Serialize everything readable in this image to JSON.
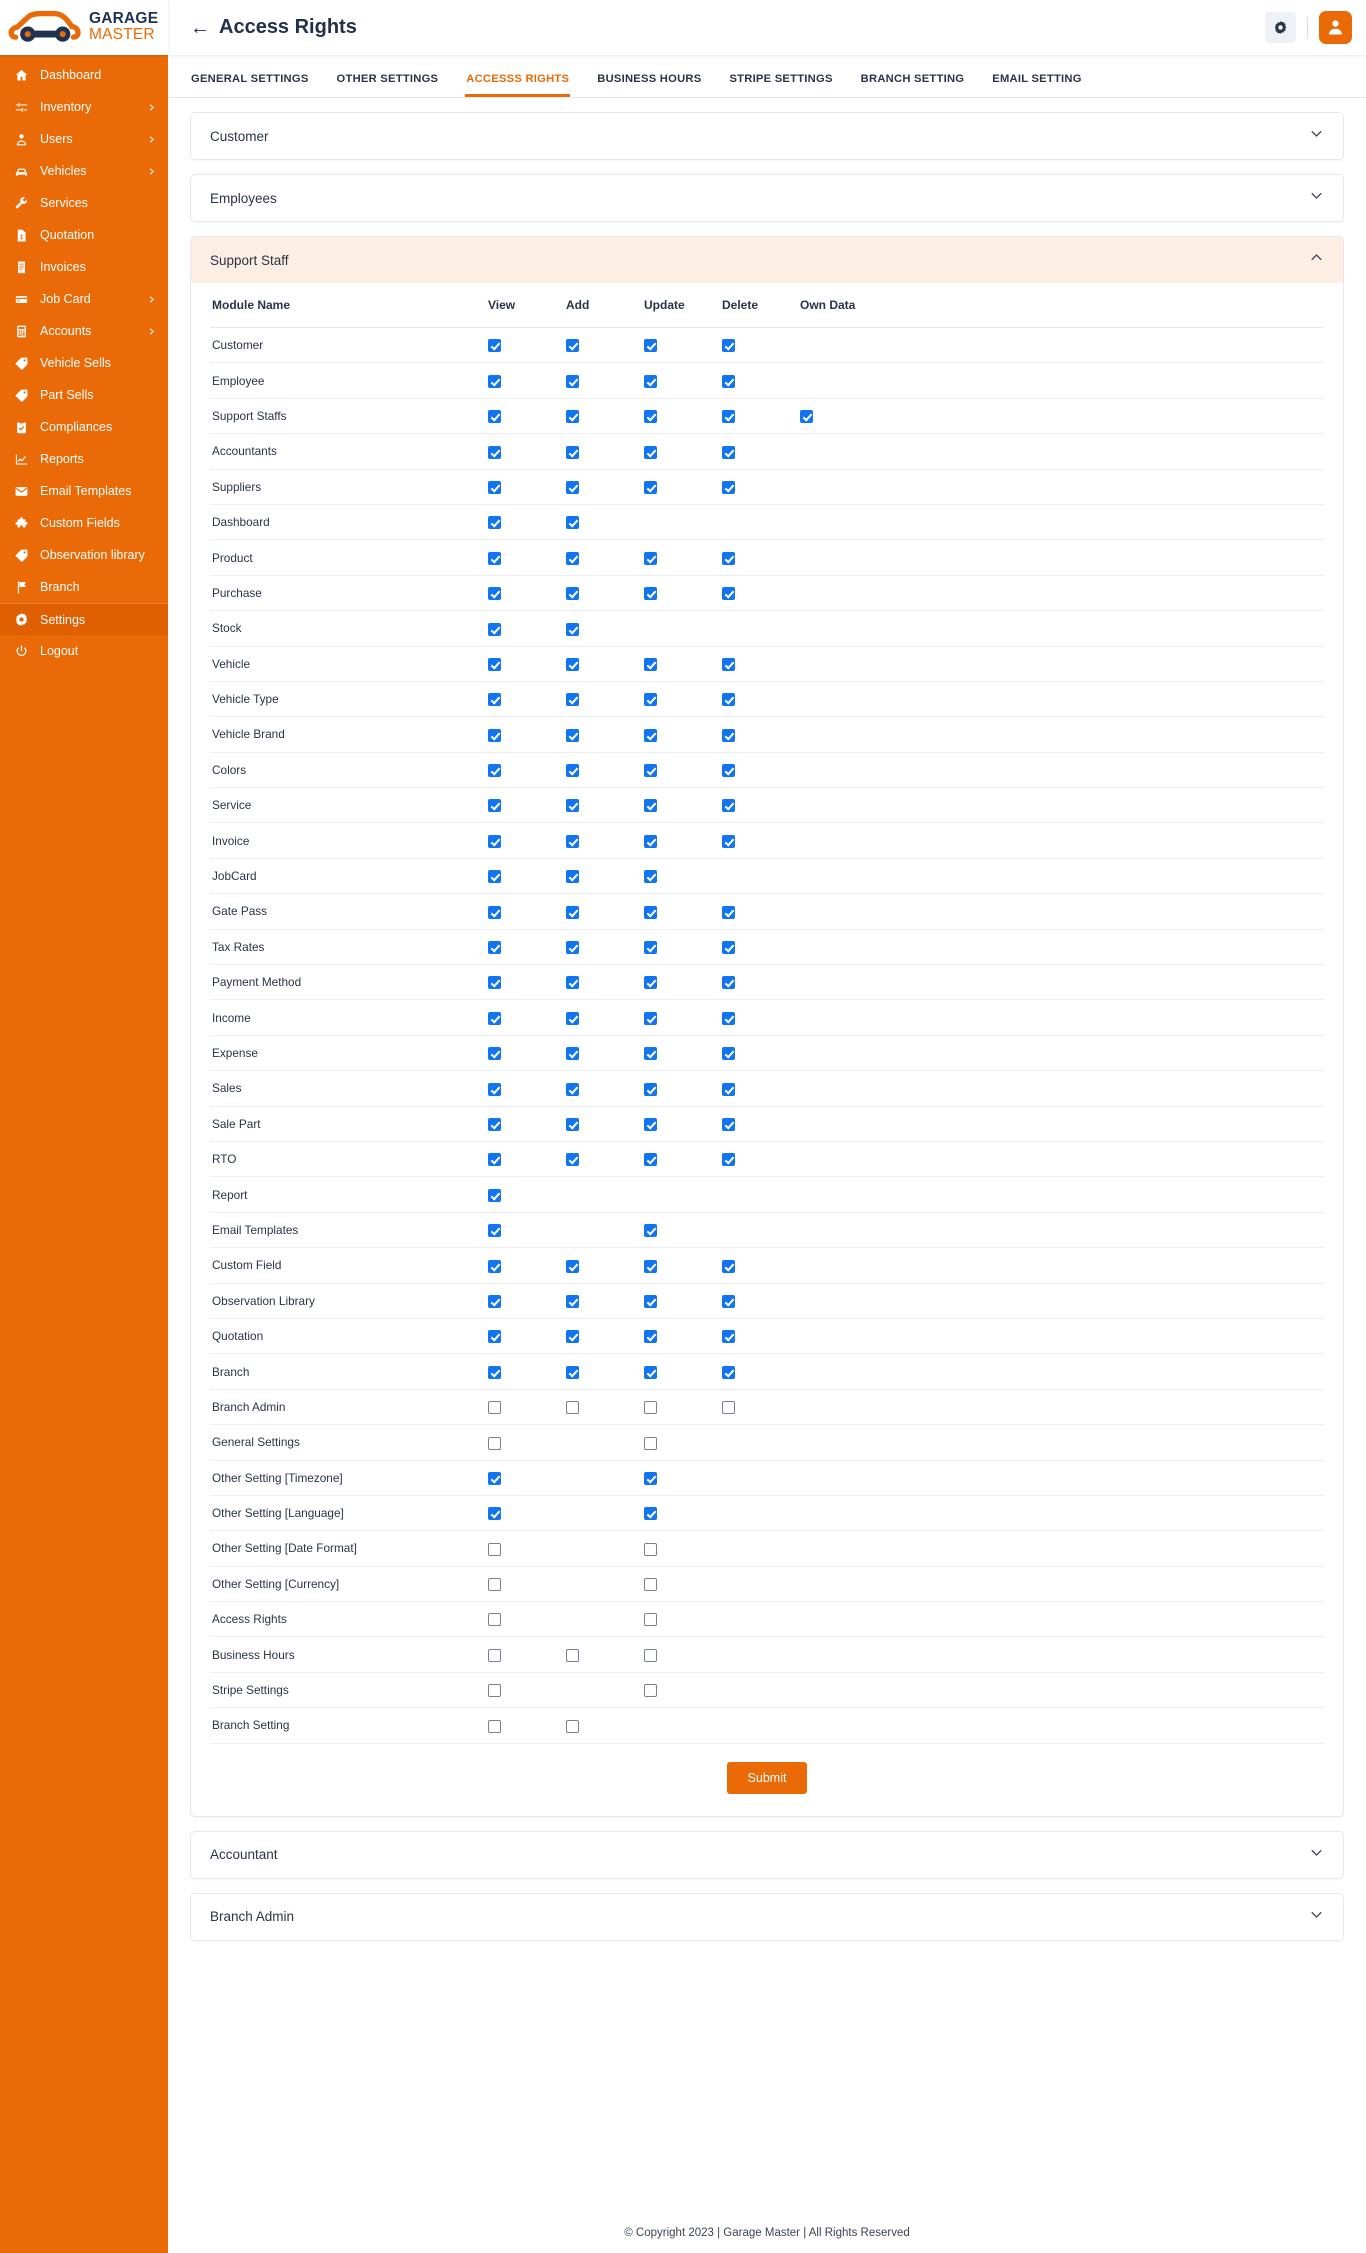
{
  "brand": {
    "line1": "GARAGE",
    "line2": "MASTER",
    "accent": "#ea6a07",
    "dark": "#1f3250"
  },
  "sidebar": {
    "items": [
      {
        "label": "Dashboard",
        "icon": "home-icon",
        "caret": false,
        "active": false
      },
      {
        "label": "Inventory",
        "icon": "sliders-icon",
        "caret": true,
        "active": false
      },
      {
        "label": "Users",
        "icon": "user-icon",
        "caret": true,
        "active": false
      },
      {
        "label": "Vehicles",
        "icon": "car-icon",
        "caret": true,
        "active": false
      },
      {
        "label": "Services",
        "icon": "wrench-icon",
        "caret": false,
        "active": false
      },
      {
        "label": "Quotation",
        "icon": "file-money-icon",
        "caret": false,
        "active": false
      },
      {
        "label": "Invoices",
        "icon": "receipt-icon",
        "caret": false,
        "active": false
      },
      {
        "label": "Job Card",
        "icon": "card-icon",
        "caret": true,
        "active": false
      },
      {
        "label": "Accounts",
        "icon": "calculator-icon",
        "caret": true,
        "active": false
      },
      {
        "label": "Vehicle Sells",
        "icon": "tag-icon",
        "caret": false,
        "active": false
      },
      {
        "label": "Part Sells",
        "icon": "tag-icon",
        "caret": false,
        "active": false
      },
      {
        "label": "Compliances",
        "icon": "clipboard-check-icon",
        "caret": false,
        "active": false
      },
      {
        "label": "Reports",
        "icon": "chart-line-icon",
        "caret": false,
        "active": false
      },
      {
        "label": "Email Templates",
        "icon": "mail-icon",
        "caret": false,
        "active": false
      },
      {
        "label": "Custom Fields",
        "icon": "puzzle-icon",
        "caret": false,
        "active": false
      },
      {
        "label": "Observation library",
        "icon": "tag-icon",
        "caret": false,
        "active": false
      },
      {
        "label": "Branch",
        "icon": "flag-icon",
        "caret": false,
        "active": false
      },
      {
        "label": "Settings",
        "icon": "gear-icon",
        "caret": false,
        "active": true
      },
      {
        "label": "Logout",
        "icon": "power-icon",
        "caret": false,
        "active": false
      }
    ]
  },
  "header": {
    "title": "Access Rights",
    "back_icon": "arrow-left-icon",
    "gear_icon": "gear-icon",
    "avatar_icon": "user-avatar-icon"
  },
  "tabs": [
    {
      "label": "GENERAL SETTINGS",
      "active": false
    },
    {
      "label": "OTHER SETTINGS",
      "active": false
    },
    {
      "label": "ACCESSS RIGHTS",
      "active": true
    },
    {
      "label": "BUSINESS HOURS",
      "active": false
    },
    {
      "label": "STRIPE SETTINGS",
      "active": false
    },
    {
      "label": "BRANCH SETTING",
      "active": false
    },
    {
      "label": "EMAIL SETTING",
      "active": false
    }
  ],
  "accordions": [
    {
      "title": "Customer",
      "open": false,
      "chevron": "chevron-down-icon"
    },
    {
      "title": "Employees",
      "open": false,
      "chevron": "chevron-down-icon"
    },
    {
      "title": "Support Staff",
      "open": true,
      "chevron": "chevron-up-icon"
    },
    {
      "title": "Accountant",
      "open": false,
      "chevron": "chevron-down-icon"
    },
    {
      "title": "Branch Admin",
      "open": false,
      "chevron": "chevron-down-icon"
    }
  ],
  "table": {
    "columns": [
      "Module Name",
      "View",
      "Add",
      "Update",
      "Delete",
      "Own Data"
    ],
    "rows": [
      {
        "module": "Customer",
        "view": true,
        "add": true,
        "update": true,
        "delete": true,
        "own": null
      },
      {
        "module": "Employee",
        "view": true,
        "add": true,
        "update": true,
        "delete": true,
        "own": null
      },
      {
        "module": "Support Staffs",
        "view": true,
        "add": true,
        "update": true,
        "delete": true,
        "own": true
      },
      {
        "module": "Accountants",
        "view": true,
        "add": true,
        "update": true,
        "delete": true,
        "own": null
      },
      {
        "module": "Suppliers",
        "view": true,
        "add": true,
        "update": true,
        "delete": true,
        "own": null
      },
      {
        "module": "Dashboard",
        "view": true,
        "add": true,
        "update": null,
        "delete": null,
        "own": null
      },
      {
        "module": "Product",
        "view": true,
        "add": true,
        "update": true,
        "delete": true,
        "own": null
      },
      {
        "module": "Purchase",
        "view": true,
        "add": true,
        "update": true,
        "delete": true,
        "own": null
      },
      {
        "module": "Stock",
        "view": true,
        "add": true,
        "update": null,
        "delete": null,
        "own": null
      },
      {
        "module": "Vehicle",
        "view": true,
        "add": true,
        "update": true,
        "delete": true,
        "own": null
      },
      {
        "module": "Vehicle Type",
        "view": true,
        "add": true,
        "update": true,
        "delete": true,
        "own": null
      },
      {
        "module": "Vehicle Brand",
        "view": true,
        "add": true,
        "update": true,
        "delete": true,
        "own": null
      },
      {
        "module": "Colors",
        "view": true,
        "add": true,
        "update": true,
        "delete": true,
        "own": null
      },
      {
        "module": "Service",
        "view": true,
        "add": true,
        "update": true,
        "delete": true,
        "own": null
      },
      {
        "module": "Invoice",
        "view": true,
        "add": true,
        "update": true,
        "delete": true,
        "own": null
      },
      {
        "module": "JobCard",
        "view": true,
        "add": true,
        "update": true,
        "delete": null,
        "own": null
      },
      {
        "module": "Gate Pass",
        "view": true,
        "add": true,
        "update": true,
        "delete": true,
        "own": null
      },
      {
        "module": "Tax Rates",
        "view": true,
        "add": true,
        "update": true,
        "delete": true,
        "own": null
      },
      {
        "module": "Payment Method",
        "view": true,
        "add": true,
        "update": true,
        "delete": true,
        "own": null
      },
      {
        "module": "Income",
        "view": true,
        "add": true,
        "update": true,
        "delete": true,
        "own": null
      },
      {
        "module": "Expense",
        "view": true,
        "add": true,
        "update": true,
        "delete": true,
        "own": null
      },
      {
        "module": "Sales",
        "view": true,
        "add": true,
        "update": true,
        "delete": true,
        "own": null
      },
      {
        "module": "Sale Part",
        "view": true,
        "add": true,
        "update": true,
        "delete": true,
        "own": null
      },
      {
        "module": "RTO",
        "view": true,
        "add": true,
        "update": true,
        "delete": true,
        "own": null
      },
      {
        "module": "Report",
        "view": true,
        "add": null,
        "update": null,
        "delete": null,
        "own": null
      },
      {
        "module": "Email Templates",
        "view": true,
        "add": null,
        "update": true,
        "delete": null,
        "own": null
      },
      {
        "module": "Custom Field",
        "view": true,
        "add": true,
        "update": true,
        "delete": true,
        "own": null
      },
      {
        "module": "Observation Library",
        "view": true,
        "add": true,
        "update": true,
        "delete": true,
        "own": null
      },
      {
        "module": "Quotation",
        "view": true,
        "add": true,
        "update": true,
        "delete": true,
        "own": null
      },
      {
        "module": "Branch",
        "view": true,
        "add": true,
        "update": true,
        "delete": true,
        "own": null
      },
      {
        "module": "Branch Admin",
        "view": false,
        "add": false,
        "update": false,
        "delete": false,
        "own": null
      },
      {
        "module": "General Settings",
        "view": false,
        "add": null,
        "update": false,
        "delete": null,
        "own": null
      },
      {
        "module": "Other Setting [Timezone]",
        "view": true,
        "add": null,
        "update": true,
        "delete": null,
        "own": null
      },
      {
        "module": "Other Setting [Language]",
        "view": true,
        "add": null,
        "update": true,
        "delete": null,
        "own": null
      },
      {
        "module": "Other Setting [Date Format]",
        "view": false,
        "add": null,
        "update": false,
        "delete": null,
        "own": null
      },
      {
        "module": "Other Setting [Currency]",
        "view": false,
        "add": null,
        "update": false,
        "delete": null,
        "own": null
      },
      {
        "module": "Access Rights",
        "view": false,
        "add": null,
        "update": false,
        "delete": null,
        "own": null
      },
      {
        "module": "Business Hours",
        "view": false,
        "add": false,
        "update": false,
        "delete": null,
        "own": null
      },
      {
        "module": "Stripe Settings",
        "view": false,
        "add": null,
        "update": false,
        "delete": null,
        "own": null
      },
      {
        "module": "Branch Setting",
        "view": false,
        "add": false,
        "update": null,
        "delete": null,
        "own": null
      }
    ]
  },
  "submit": {
    "label": "Submit"
  },
  "footer": {
    "text": "© Copyright 2023 | Garage Master | All Rights Reserved"
  }
}
